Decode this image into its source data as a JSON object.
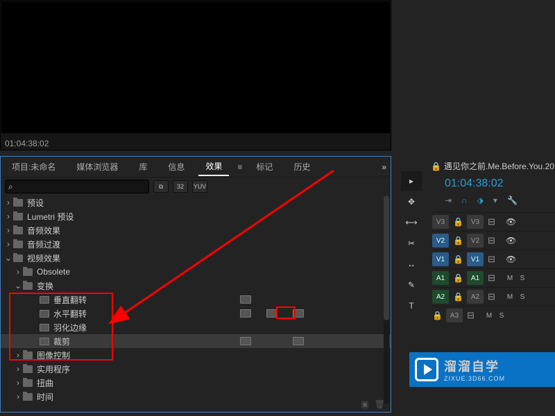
{
  "preview": {
    "timecode": "01:04:38:02"
  },
  "tabs": {
    "project": "项目:未命名",
    "media": "媒体浏览器",
    "library": "库",
    "info": "信息",
    "effects": "效果",
    "markers": "标记",
    "history": "历史",
    "menu_glyph": "≡",
    "more_glyph": "»"
  },
  "search": {
    "placeholder": "",
    "icon": "⌕"
  },
  "filters": {
    "a": "⧉",
    "b": "32",
    "c": "YUV"
  },
  "tree": {
    "presets": "预设",
    "lumetri": "Lumetri 预设",
    "audio_fx": "音频效果",
    "audio_tr": "音频过渡",
    "video_fx": "视频效果",
    "obsolete": "Obsolete",
    "transform": "变换",
    "vflip": "垂直翻转",
    "hflip": "水平翻转",
    "feather": "羽化边缘",
    "crop": "裁剪",
    "image_ctrl": "图像控制",
    "utility": "实用程序",
    "distort": "扭曲",
    "time": "时间"
  },
  "timeline": {
    "title": "遇见你之前.Me.Before.You.20",
    "timecode": "01:04:38:02",
    "tracks": {
      "v3": "V3",
      "v2": "V2",
      "v1": "V1",
      "a1": "A1",
      "a2": "A2",
      "a3": "A3"
    },
    "val": "0.0"
  },
  "tools": {
    "select": "▸",
    "track_sel": "✥",
    "ripple": "⟷",
    "razor": "✂",
    "slip": "↔",
    "pen": "✎",
    "type": "T"
  },
  "watermark": {
    "cn": "溜溜自学",
    "en": "ZIXUE.3D66.COM"
  }
}
